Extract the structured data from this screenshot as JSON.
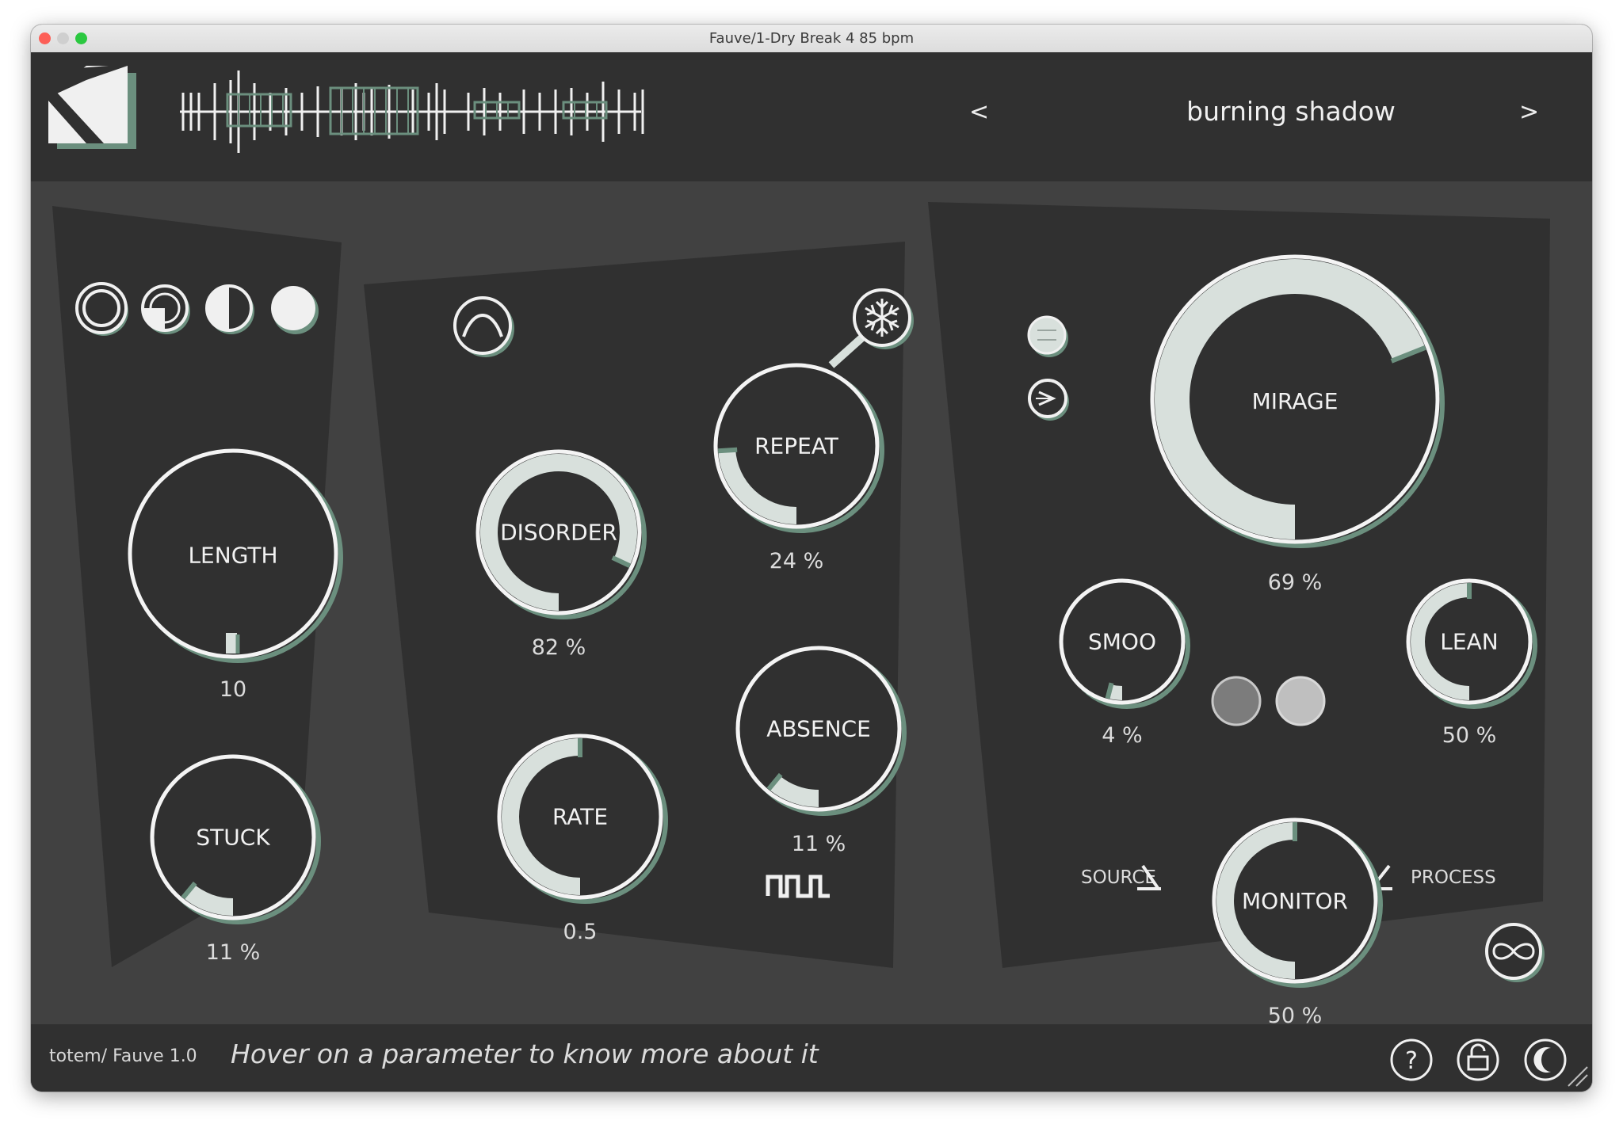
{
  "window": {
    "title": "Fauve/1-Dry Break 4 85 bpm"
  },
  "preset": {
    "prev": "<",
    "name": "burning shadow",
    "next": ">"
  },
  "colors": {
    "accent": "#6b8f7e",
    "knob_fill": "#d8e0dc",
    "panel": "#303030",
    "bg": "#414141",
    "text": "#f2f2f2"
  },
  "knobs": {
    "length": {
      "label": "LENGTH",
      "value": "10"
    },
    "stuck": {
      "label": "STUCK",
      "value": "11 %"
    },
    "disorder": {
      "label": "DISORDER",
      "value": "82 %"
    },
    "rate": {
      "label": "RATE",
      "value": "0.5"
    },
    "repeat": {
      "label": "REPEAT",
      "value": "24 %"
    },
    "absence": {
      "label": "ABSENCE",
      "value": "11 %"
    },
    "mirage": {
      "label": "MIRAGE",
      "value": "69 %"
    },
    "smoo": {
      "label": "SMOO",
      "value": "4 %"
    },
    "lean": {
      "label": "LEAN",
      "value": "50 %"
    },
    "monitor": {
      "label": "MONITOR",
      "value": "50 %"
    }
  },
  "knob_levels": {
    "stuck": 0.11,
    "disorder": 0.82,
    "rate": 0.5,
    "repeat": 0.24,
    "absence": 0.11,
    "mirage": 0.69,
    "smoo": 0.04,
    "lean": 0.5,
    "monitor": 0.5
  },
  "monitor_labels": {
    "source": "SOURCE",
    "process": "PROCESS"
  },
  "icons": {
    "shape_selector": [
      "circle-outline-icon",
      "circle-three-quarter-icon",
      "circle-half-icon",
      "circle-full-icon"
    ],
    "envelope": "envelope-curve-icon",
    "freeze": "snowflake-icon",
    "gate": "square-wave-icon",
    "mirage_modes": [
      "minus-icon",
      "play-arrow-icon"
    ],
    "dots": [
      "dot-dark-icon",
      "dot-light-icon"
    ],
    "loop": "infinity-icon",
    "footer": [
      "help-icon",
      "lock-icon",
      "moon-icon"
    ]
  },
  "footer": {
    "version": "totem/ Fauve 1.0",
    "help_text": "Hover on a parameter to know more about it"
  }
}
